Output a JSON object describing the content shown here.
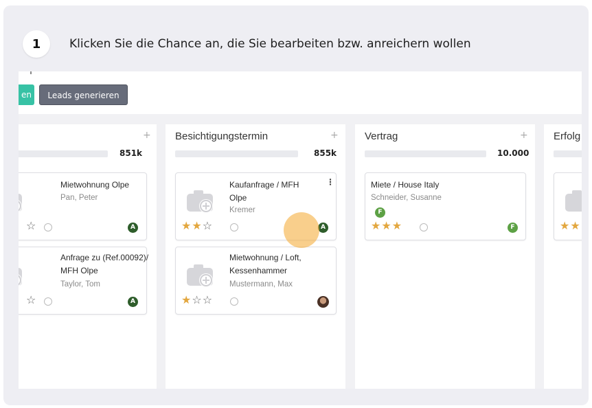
{
  "step": {
    "number": "1",
    "instruction": "Klicken Sie die Chance an, die Sie bearbeiten bzw. anreichern wollen"
  },
  "toolbar": {
    "teal_button_label": "en",
    "leads_button_label": "Leads generieren"
  },
  "columns": [
    {
      "title": "",
      "sum": "851k",
      "plus": "+"
    },
    {
      "title": "Besichtigungstermin",
      "sum": "855k",
      "plus": "+"
    },
    {
      "title": "Vertrag",
      "sum": "10.000",
      "plus": "+"
    },
    {
      "title": "Erfolg",
      "plus": "+"
    }
  ],
  "cards": {
    "c1": {
      "title": "Mietwohnung Olpe",
      "contact": "Pan, Peter",
      "stars": 0,
      "avatar": "A"
    },
    "c2": {
      "title": "Anfrage zu (Ref.00092)/ MFH Olpe",
      "contact": "Taylor, Tom",
      "stars": 0,
      "avatar": "A"
    },
    "c3": {
      "title": "Kaufanfrage / MFH Olpe",
      "contact": "Kremer",
      "stars": 2,
      "avatar": "A",
      "menu": "⋮"
    },
    "c4": {
      "title": "Mietwohnung / Loft, Kessenhammer",
      "contact": "Mustermann, Max",
      "stars": 1
    },
    "c5": {
      "title": "Miete / House Italy",
      "contact": "Schneider, Susanne",
      "stars": 3,
      "avatar": "F",
      "owner_badge": "F"
    }
  },
  "icons": {
    "star_filled": "★",
    "star_empty": "☆"
  },
  "colors": {
    "teal": "#37c2a5",
    "star": "#e3a73f",
    "avatar_dark": "#2e5d2b",
    "avatar_light": "#5da145",
    "click_marker": "#f5b246"
  }
}
